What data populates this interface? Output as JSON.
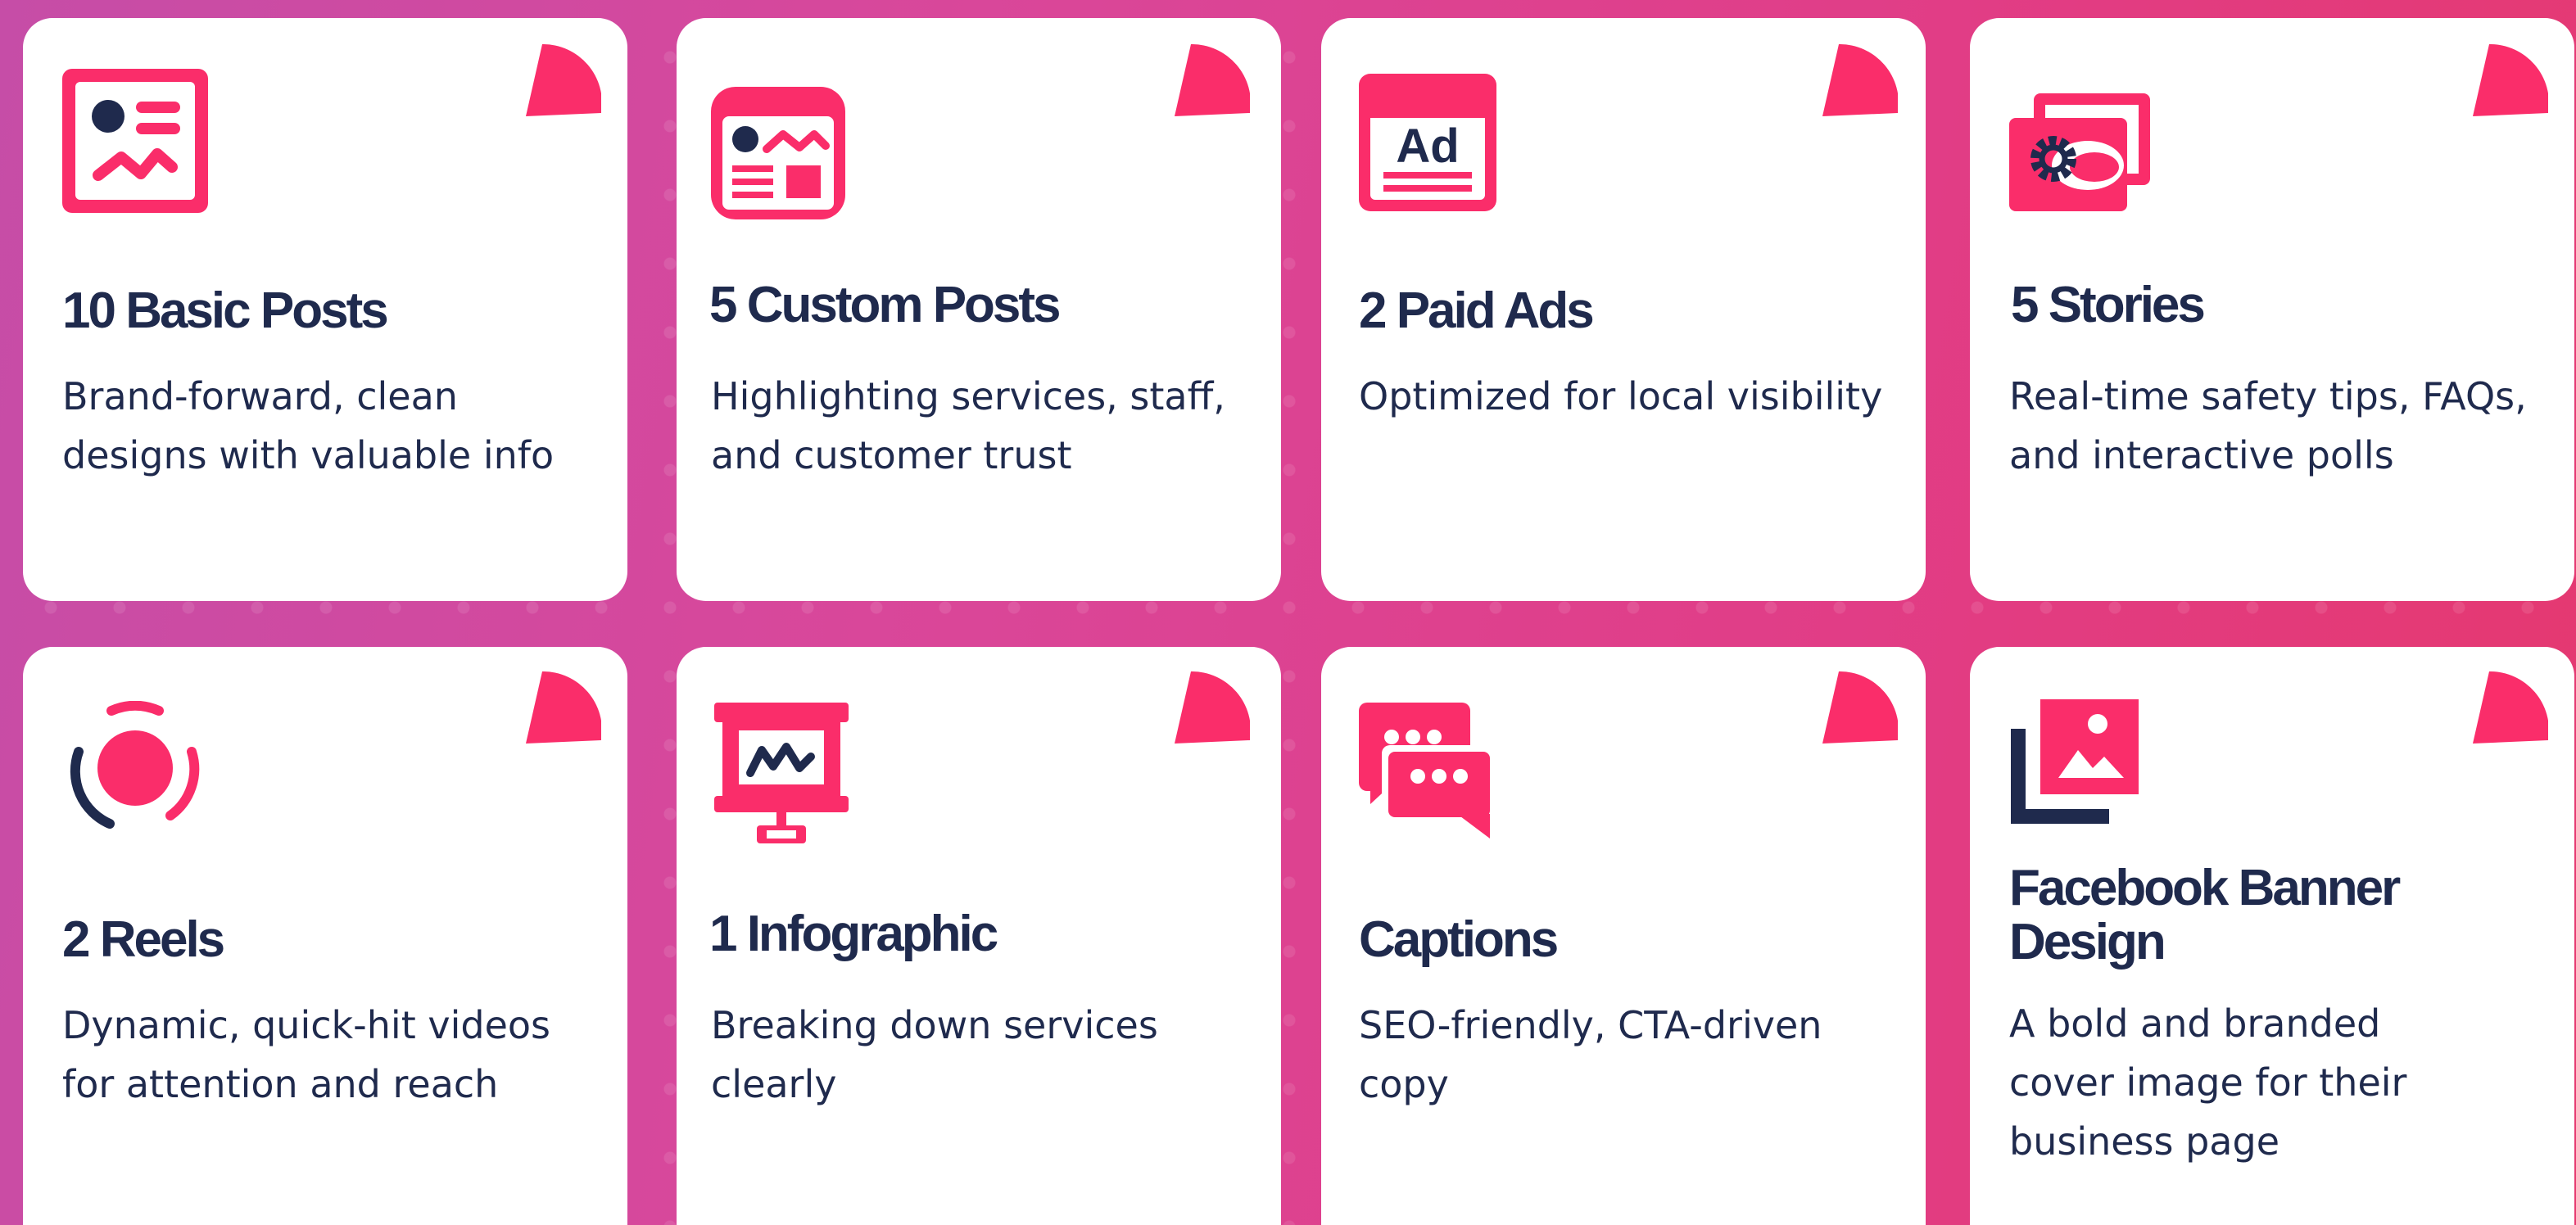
{
  "colors": {
    "accent": "#fa2d6a",
    "navy": "#1f2a4d",
    "card_background": "#ffffff",
    "background_start": "#c64da7",
    "background_end": "#e5386f"
  },
  "cards": [
    {
      "title": "10 Basic Posts",
      "description": "Brand-forward, clean designs with valuable info",
      "icon": "basic-post-icon"
    },
    {
      "title": "5 Custom Posts",
      "description": "Highlighting services, staff, and customer trust",
      "icon": "custom-post-icon"
    },
    {
      "title": "2 Paid Ads",
      "description": "Optimized for local visibility",
      "icon": "ad-icon",
      "icon_text": "Ad"
    },
    {
      "title": "5 Stories",
      "description": "Real-time safety tips, FAQs, and interactive polls",
      "icon": "stories-icon"
    },
    {
      "title": "2 Reels",
      "description": "Dynamic, quick-hit videos for attention and reach",
      "icon": "reels-icon"
    },
    {
      "title": "1 Infographic",
      "description": "Breaking down services clearly",
      "icon": "infographic-icon"
    },
    {
      "title": "Captions",
      "description": "SEO-friendly, CTA-driven copy",
      "icon": "captions-icon"
    },
    {
      "title": "Facebook Banner Design",
      "description": "A bold and branded cover image for their business page",
      "icon": "banner-image-icon"
    }
  ]
}
